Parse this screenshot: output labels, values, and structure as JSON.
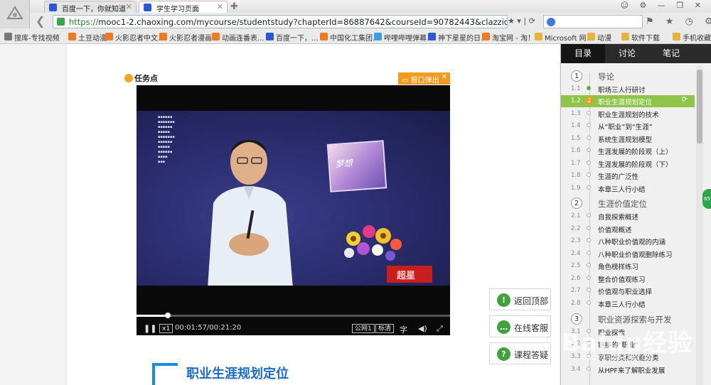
{
  "browser": {
    "tabs": [
      {
        "label": "百度一下，你就知道",
        "active": false
      },
      {
        "label": "学生学习页面",
        "active": true
      }
    ],
    "url_scheme": "https://",
    "url_rest": "mooc1-2.chaoxing.com/mycourse/studentstudy?chapterId=86887642&courseId=90782443&clazzid=874926&enc",
    "bookmarks": [
      "搜库-专找视频",
      "土豆动漫",
      "火影忍者中文...",
      "火影忍者漫画...",
      "动画连番表...",
      "百度一下，...",
      "中国化工集团...",
      "哔哩哔哩弹幕...",
      "神下星星的日...",
      "淘宝网 - 淘！...",
      "Microsoft 网...",
      "动漫",
      "软件下载",
      "手机收藏"
    ]
  },
  "task": {
    "label": "任务点",
    "popout_label": "窗口弹出"
  },
  "video": {
    "time": "00:01:57/00:21:20",
    "progress": 0.1,
    "speed_label": "x1",
    "line_label": "公网1",
    "quality_label": "标清",
    "subtitle_label": "字",
    "pic_text": "梦想",
    "brand": "超星"
  },
  "float_buttons": [
    {
      "label": "返回顶部",
      "icon": "!"
    },
    {
      "label": "在线客服",
      "icon": "…"
    },
    {
      "label": "课程答疑",
      "icon": "?"
    }
  ],
  "section_title": "职业生涯规划定位",
  "sidebar": {
    "tabs": [
      "目录",
      "讨论",
      "笔记"
    ],
    "chapters": [
      {
        "num": "1",
        "title": "导论"
      },
      {
        "num": "2",
        "title": "生涯价值定位"
      },
      {
        "num": "3",
        "title": "职业资源探索与开发"
      }
    ],
    "sections": [
      {
        "n": "1.1",
        "title": "职场三人行研讨"
      },
      {
        "n": "1.2",
        "title": "职业生涯规划定位"
      },
      {
        "n": "1.3",
        "title": "职业生涯规划的技术"
      },
      {
        "n": "1.4",
        "title": "从“职业”到“生涯”"
      },
      {
        "n": "1.5",
        "title": "系统生涯规划模型"
      },
      {
        "n": "1.6",
        "title": "生涯发展的阶段观（上）"
      },
      {
        "n": "1.7",
        "title": "生涯发展的阶段观（下）"
      },
      {
        "n": "1.8",
        "title": "生涯的广泛性"
      },
      {
        "n": "1.9",
        "title": "本章三人行小结"
      },
      {
        "n": "2.1",
        "title": "自我探索概述"
      },
      {
        "n": "2.2",
        "title": "价值观概述"
      },
      {
        "n": "2.3",
        "title": "八种职业价值观的内涵"
      },
      {
        "n": "2.4",
        "title": "八种职业价值观删除练习"
      },
      {
        "n": "2.5",
        "title": "角色榜样练习"
      },
      {
        "n": "2.6",
        "title": "整合价值观练习"
      },
      {
        "n": "2.7",
        "title": "价值观与职业选择"
      },
      {
        "n": "2.8",
        "title": "本章三人行小结"
      },
      {
        "n": "3.1",
        "title": "职业探索"
      },
      {
        "n": "3.2",
        "title": "链接的“职业”"
      },
      {
        "n": "3.3",
        "title": "享职分类和兴趣分类"
      },
      {
        "n": "3.4",
        "title": "从HPF来了解职业发展"
      }
    ]
  },
  "watermark": {
    "main": "Baidu经验",
    "sub": "jingyan.baidu.com"
  },
  "colors": {
    "accent_orange": "#f39b1f",
    "current_green": "#8fc44a",
    "title_blue": "#1a6cc7"
  }
}
